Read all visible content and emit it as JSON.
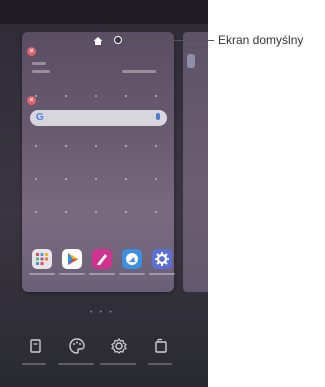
{
  "callout": {
    "label": "Ekran domyślny"
  },
  "search": {
    "logo": "G"
  },
  "page_indicator": "• • •",
  "colors": {
    "background": "#2f2b35",
    "card": "#6a5b70",
    "remove_button": "#e4616a",
    "search_bar": "#d9d5dd",
    "google_blue": "#4285f4"
  },
  "icons": {
    "home": "home-icon",
    "remove": "close-icon",
    "mic": "mic-icon",
    "wallpapers": "wallpaper-icon",
    "themes": "palette-icon",
    "settings": "gear-icon",
    "widgets": "widget-icon"
  }
}
